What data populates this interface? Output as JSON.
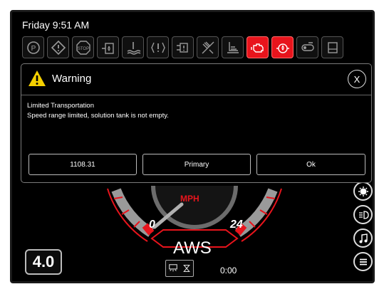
{
  "status": {
    "time": "Friday 9:51 AM"
  },
  "indicators": [
    {
      "name": "parking-brake-icon",
      "active": false
    },
    {
      "name": "warning-diamond-icon",
      "active": false
    },
    {
      "name": "stop-icon",
      "active": false
    },
    {
      "name": "hydraulic-oil-icon",
      "active": false
    },
    {
      "name": "coolant-temp-icon",
      "active": false
    },
    {
      "name": "battery-warning-icon",
      "active": false
    },
    {
      "name": "filter-warning-icon",
      "active": false
    },
    {
      "name": "brush-off-icon",
      "active": false
    },
    {
      "name": "exhaust-icon",
      "active": false
    },
    {
      "name": "engine-warning-icon",
      "active": true
    },
    {
      "name": "oil-pressure-icon",
      "active": true
    },
    {
      "name": "key-switch-icon",
      "active": false
    },
    {
      "name": "tank-icon",
      "active": false
    }
  ],
  "dialog": {
    "title": "Warning",
    "close_label": "X",
    "message_title": "Limited Transportation",
    "message_body": "Speed range limited, solution tank is not empty.",
    "buttons": [
      "1108.31",
      "Primary",
      "Ok"
    ]
  },
  "gauge": {
    "unit": "MPH",
    "min_label": "0",
    "max_label": "24",
    "mode": "AWS",
    "needle_value": 0
  },
  "speed_display": "4.0",
  "timer": "0:00",
  "side_buttons": [
    "work-light-icon",
    "headlight-icon",
    "music-icon",
    "menu-icon"
  ],
  "colors": {
    "accent_red": "#e8141c",
    "background": "#000000"
  }
}
